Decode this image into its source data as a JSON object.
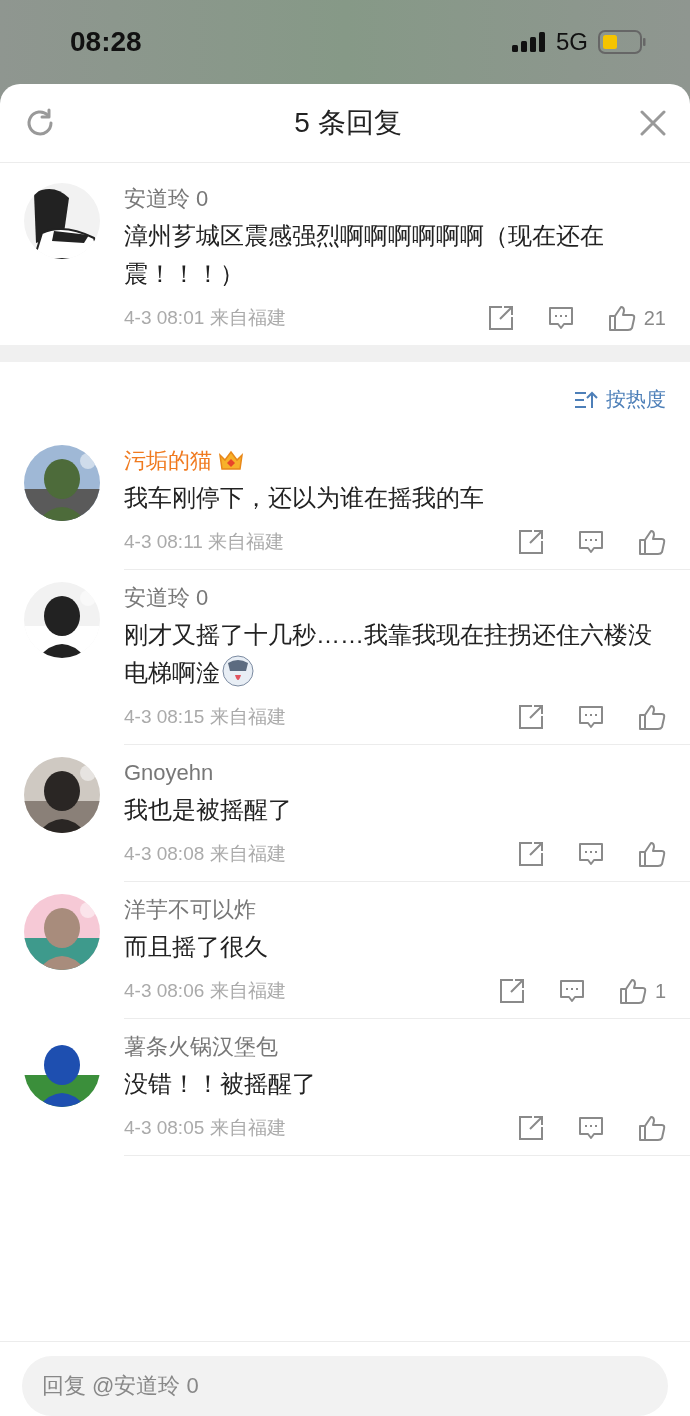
{
  "status_bar": {
    "time": "08:28",
    "network": "5G"
  },
  "header": {
    "title": "5 条回复"
  },
  "root_comment": {
    "author": "安道玲 0",
    "text": "漳州芗城区震感强烈啊啊啊啊啊啊（现在还在震！！！）",
    "time": "4-3 08:01",
    "location": "来自福建",
    "likes": "21"
  },
  "sort": {
    "label": "按热度"
  },
  "replies": [
    {
      "author": "污垢的猫",
      "vip": true,
      "text": "我车刚停下，还以为谁在摇我的车",
      "emoji": false,
      "time": "4-3 08:11",
      "location": "来自福建"
    },
    {
      "author": "安道玲 0",
      "vip": false,
      "text": "刚才又摇了十几秒……我靠我现在拄拐还住六楼没电梯啊淦",
      "emoji": true,
      "time": "4-3 08:15",
      "location": "来自福建"
    },
    {
      "author": "Gnoyehn",
      "vip": false,
      "text": "我也是被摇醒了",
      "emoji": false,
      "time": "4-3 08:08",
      "location": "来自福建"
    },
    {
      "author": "洋芋不可以炸",
      "vip": false,
      "text": "而且摇了很久",
      "emoji": false,
      "time": "4-3 08:06",
      "location": "来自福建",
      "likes": "1"
    },
    {
      "author": "薯条火锅汉堡包",
      "vip": false,
      "text": "没错！！被摇醒了",
      "emoji": false,
      "time": "4-3 08:05",
      "location": "来自福建"
    }
  ],
  "reply_box": {
    "placeholder": "回复 @安道玲 0"
  }
}
